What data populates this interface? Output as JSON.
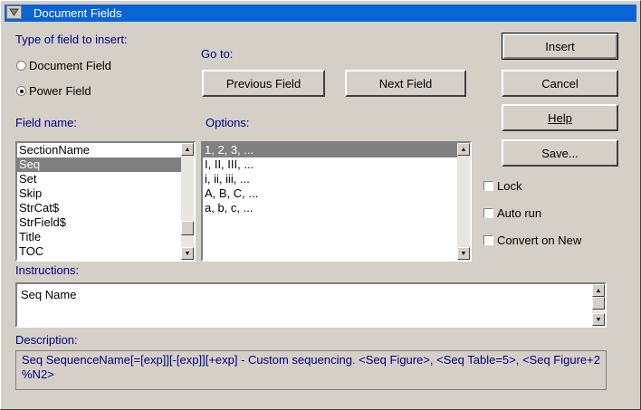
{
  "window": {
    "title": "Document Fields"
  },
  "type_group": {
    "label": "Type of field to insert:",
    "options": [
      {
        "label": "Document Field",
        "selected": false
      },
      {
        "label": "Power Field",
        "selected": true
      }
    ]
  },
  "goto": {
    "label": "Go to:",
    "prev_label": "Previous Field",
    "next_label": "Next Field"
  },
  "field_name": {
    "label": "Field name:",
    "items": [
      "SectionName",
      "Seq",
      "Set",
      "Skip",
      "StrCat$",
      "StrField$",
      "Title",
      "TOC"
    ],
    "selected": "Seq"
  },
  "options": {
    "label": "Options:",
    "items": [
      "1, 2, 3, ...",
      "I, II, III, ...",
      "i, ii, iii, ...",
      "A, B, C, ...",
      "a, b, c, ..."
    ],
    "selected": "1, 2, 3, ..."
  },
  "buttons": {
    "insert": "Insert",
    "cancel": "Cancel",
    "help": "Help",
    "save": "Save..."
  },
  "checkboxes": [
    {
      "label": "Lock",
      "checked": false
    },
    {
      "label": "Auto run",
      "checked": false
    },
    {
      "label": "Convert on New",
      "checked": false
    }
  ],
  "instructions": {
    "label": "Instructions:",
    "value": "Seq Name"
  },
  "description": {
    "label": "Description:",
    "text": "Seq SequenceName[=[exp]][-[exp]][+exp] - Custom sequencing.  <Seq Figure>, <Seq Table=5>, <Seq Figure+2 %N2>"
  },
  "colors": {
    "titlebar": "#0a64d6",
    "label_text": "#000080",
    "selection": "#808080",
    "face": "#d4d0c8"
  }
}
